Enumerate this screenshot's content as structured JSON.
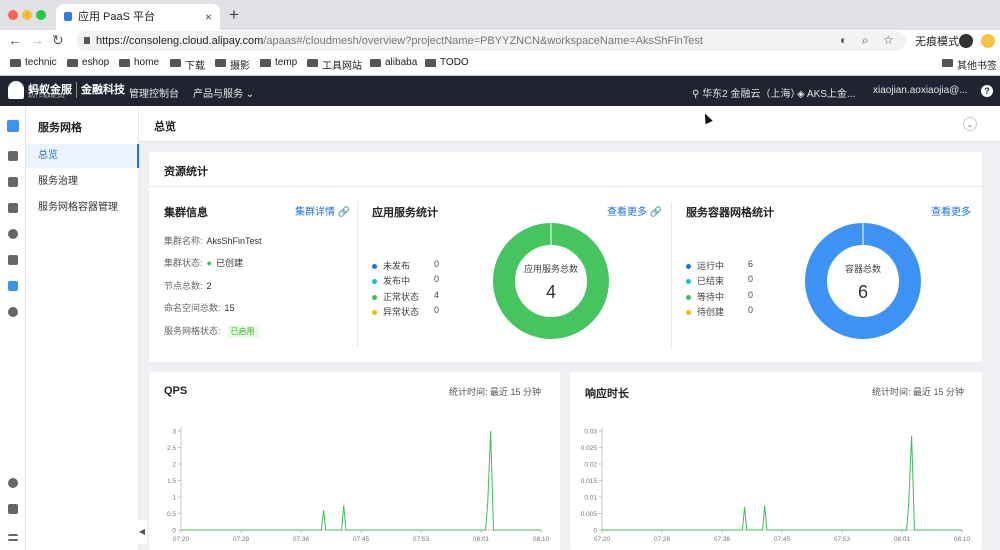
{
  "browser": {
    "tab_title": "应用 PaaS 平台",
    "tab_close": "×",
    "new_tab": "+",
    "url_host": "https://consoleng.cloud.alipay.com",
    "url_path": "/apaas#/cloudmesh/overview?projectName=PBYYZNCN&workspaceName=AksShFinTest",
    "incognito_label": "无痕模式",
    "bookmarks": [
      "technic",
      "eshop",
      "home",
      "下载",
      "摄影",
      "temp",
      "工具网站",
      "alibaba",
      "TODO"
    ],
    "other_bookmarks": "其他书签"
  },
  "appbar": {
    "brand": "蚂蚁金服",
    "brand_sub": "ANT FINANCIAL",
    "brand_product": "金融科技",
    "console": "管理控制台",
    "products": "产品与服务 ⌄",
    "region": "华东2 金融云（上海）",
    "workspace": "AKS上金...",
    "user": "xiaojian.aoxiaojia@...",
    "help": "?"
  },
  "sidebar": {
    "title": "服务网格",
    "items": [
      {
        "label": "总览",
        "active": true
      },
      {
        "label": "服务治理",
        "active": false
      },
      {
        "label": "服务网格容器管理",
        "active": false
      }
    ]
  },
  "page": {
    "title": "总览",
    "collapse": "⌄"
  },
  "resource": {
    "title": "资源统计",
    "cluster": {
      "head": "集群信息",
      "detail_link": "集群详情 🔗",
      "name_label": "集群名称:",
      "name_value": "AksShFinTest",
      "status_label": "集群状态:",
      "status_value": "已创建",
      "nodes_label": "节点总数:",
      "nodes_value": "2",
      "ns_label": "命名空间总数:",
      "ns_value": "15",
      "mesh_label": "服务网格状态:",
      "mesh_value": "已启用"
    },
    "app_stats": {
      "head": "应用服务统计",
      "more": "查看更多 🔗",
      "center_label": "应用服务总数",
      "center_value": "4",
      "legend": [
        {
          "label": "未发布",
          "value": "0",
          "color": "#1b73e8"
        },
        {
          "label": "发布中",
          "value": "0",
          "color": "#13c2c2"
        },
        {
          "label": "正常状态",
          "value": "4",
          "color": "#3fbf5a"
        },
        {
          "label": "异常状态",
          "value": "0",
          "color": "#f5b700"
        }
      ],
      "ring_color": "#45c55e"
    },
    "container_stats": {
      "head": "服务容器网格统计",
      "more": "查看更多",
      "center_label": "容器总数",
      "center_value": "6",
      "legend": [
        {
          "label": "运行中",
          "value": "6",
          "color": "#1b73e8"
        },
        {
          "label": "已结束",
          "value": "0",
          "color": "#13c2c2"
        },
        {
          "label": "等待中",
          "value": "0",
          "color": "#3fbf5a"
        },
        {
          "label": "待创建",
          "value": "0",
          "color": "#f5b700"
        }
      ],
      "ring_color": "#3d93f5"
    }
  },
  "qps": {
    "title": "QPS",
    "stat_time": "统计时间:  最近 15 分钟"
  },
  "latency": {
    "title": "响应时长",
    "stat_time": "统计时间:  最近 15 分钟"
  },
  "chart_data": [
    {
      "type": "line",
      "title": "QPS",
      "x_ticks": [
        "07:20",
        "07:28",
        "07:36",
        "07:45",
        "07:53",
        "08:01",
        "08:10"
      ],
      "y_ticks": [
        "0",
        "0.5",
        "1",
        "1.5",
        "2",
        "2.5",
        "3"
      ],
      "ylim": [
        0,
        3
      ],
      "xlim_minutes": [
        0,
        50
      ],
      "color": "#3fbf5a",
      "points": [
        [
          0,
          0
        ],
        [
          19.5,
          0
        ],
        [
          19.8,
          0.6
        ],
        [
          20.1,
          0
        ],
        [
          22.3,
          0
        ],
        [
          22.6,
          0.75
        ],
        [
          22.9,
          0
        ],
        [
          42.3,
          0
        ],
        [
          42.6,
          0.8
        ],
        [
          43.0,
          3.0
        ],
        [
          43.4,
          0
        ],
        [
          50,
          0
        ]
      ]
    },
    {
      "type": "line",
      "title": "响应时长",
      "x_ticks": [
        "07:20",
        "07:28",
        "07:36",
        "07:45",
        "07:53",
        "08:01",
        "08:10"
      ],
      "y_ticks": [
        "0",
        "0.005",
        "0.01",
        "0.015",
        "0.02",
        "0.025",
        "0.03"
      ],
      "ylim": [
        0,
        0.03
      ],
      "xlim_minutes": [
        0,
        50
      ],
      "color": "#3fbf5a",
      "points": [
        [
          0,
          0
        ],
        [
          19.5,
          0
        ],
        [
          19.8,
          0.007
        ],
        [
          20.1,
          0
        ],
        [
          22.3,
          0
        ],
        [
          22.6,
          0.0075
        ],
        [
          22.9,
          0
        ],
        [
          42.3,
          0
        ],
        [
          42.6,
          0.008
        ],
        [
          43.0,
          0.0285
        ],
        [
          43.4,
          0
        ],
        [
          50,
          0
        ]
      ]
    }
  ]
}
